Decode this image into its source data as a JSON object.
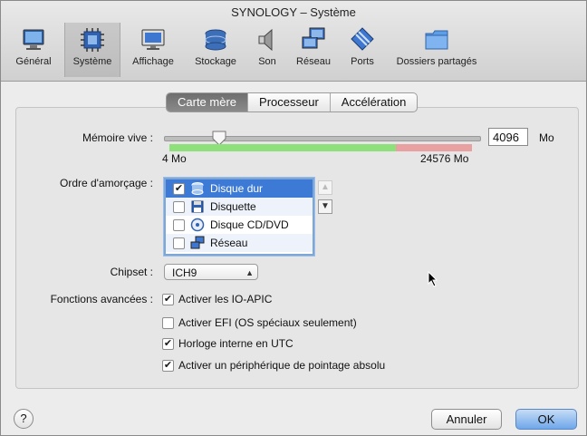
{
  "window": {
    "title": "SYNOLOGY – Système"
  },
  "toolbar": {
    "items": [
      {
        "label": "Général",
        "icon": "monitor-icon"
      },
      {
        "label": "Système",
        "icon": "chip-icon",
        "active": true
      },
      {
        "label": "Affichage",
        "icon": "display-icon"
      },
      {
        "label": "Stockage",
        "icon": "disk-stack-icon"
      },
      {
        "label": "Son",
        "icon": "speaker-icon"
      },
      {
        "label": "Réseau",
        "icon": "network-icon"
      },
      {
        "label": "Ports",
        "icon": "port-plug-icon"
      },
      {
        "label": "Dossiers partagés",
        "icon": "folder-icon"
      }
    ]
  },
  "tabs": [
    {
      "label": "Carte mère",
      "selected": true
    },
    {
      "label": "Processeur",
      "selected": false
    },
    {
      "label": "Accélération",
      "selected": false
    }
  ],
  "memory": {
    "label": "Mémoire vive :",
    "value": "4096",
    "unit": "Mo",
    "min_label": "4 Mo",
    "max_label": "24576 Mo"
  },
  "boot": {
    "label": "Ordre d'amorçage :",
    "items": [
      {
        "label": "Disque dur",
        "checked": true,
        "selected": true,
        "icon": "hard-disk-icon"
      },
      {
        "label": "Disquette",
        "checked": false,
        "icon": "floppy-icon"
      },
      {
        "label": "Disque CD/DVD",
        "checked": false,
        "icon": "cd-icon"
      },
      {
        "label": "Réseau",
        "checked": false,
        "icon": "network-icon"
      }
    ]
  },
  "chipset": {
    "label": "Chipset :",
    "value": "ICH9"
  },
  "advanced": {
    "label": "Fonctions avancées :",
    "options": [
      {
        "label": "Activer les IO-APIC",
        "checked": true
      },
      {
        "label": "Activer EFI (OS spéciaux seulement)",
        "checked": false
      },
      {
        "label": "Horloge interne en UTC",
        "checked": true
      },
      {
        "label": "Activer un périphérique de pointage absolu",
        "checked": true
      }
    ]
  },
  "buttons": {
    "help": "?",
    "cancel": "Annuler",
    "ok": "OK"
  }
}
